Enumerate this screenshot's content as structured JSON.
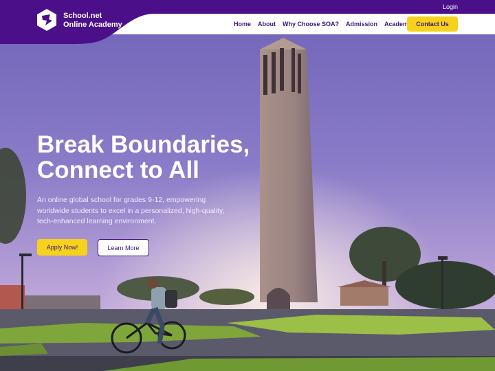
{
  "header": {
    "login_label": "Login",
    "brand_line1": "School.net",
    "brand_line2": "Online Academy",
    "nav": [
      "Home",
      "About",
      "Why Choose SOA?",
      "Admission",
      "Academics"
    ],
    "contact_label": "Contact Us"
  },
  "hero": {
    "headline_line1": "Break Boundaries,",
    "headline_line2": "Connect to All",
    "description": "An online global school for grades 9-12, empowering worldwide students to excel in a personalized, high-quality, tech-enhanced learning environment.",
    "apply_label": "Apply Now!",
    "learn_label": "Learn More"
  },
  "colors": {
    "brand_purple": "#4b0f8a",
    "accent_yellow": "#f7d21c",
    "nav_text": "#3d1278"
  }
}
